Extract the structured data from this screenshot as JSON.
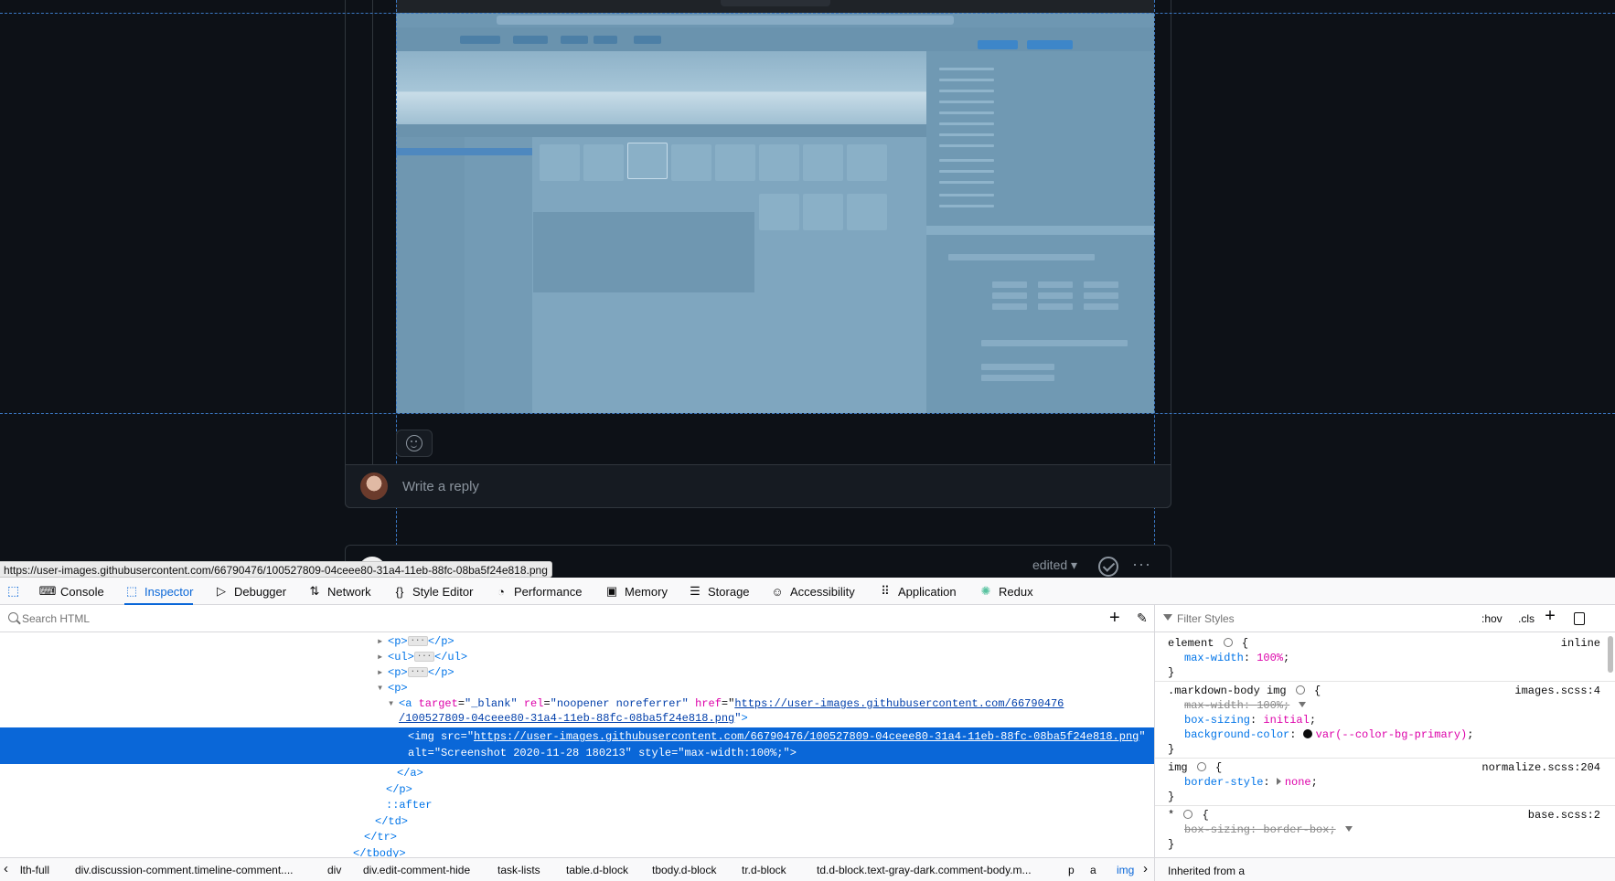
{
  "page": {
    "reply_placeholder": "Write a reply",
    "edited_label": "edited",
    "status_url": "https://user-images.githubusercontent.com/66790476/100527809-04ceee80-31a4-11eb-88fc-08ba5f24e818.png"
  },
  "devtools": {
    "tabs": [
      {
        "label": "Console",
        "icon": "console-icon"
      },
      {
        "label": "Inspector",
        "icon": "inspector-icon"
      },
      {
        "label": "Debugger",
        "icon": "debugger-icon"
      },
      {
        "label": "Network",
        "icon": "network-icon"
      },
      {
        "label": "Style Editor",
        "icon": "style-editor-icon"
      },
      {
        "label": "Performance",
        "icon": "performance-icon"
      },
      {
        "label": "Memory",
        "icon": "memory-icon"
      },
      {
        "label": "Storage",
        "icon": "storage-icon"
      },
      {
        "label": "Accessibility",
        "icon": "accessibility-icon"
      },
      {
        "label": "Application",
        "icon": "application-icon"
      },
      {
        "label": "Redux",
        "icon": "redux-icon"
      }
    ],
    "active_tab": "Inspector",
    "search_placeholder": "Search HTML",
    "filter_placeholder": "Filter Styles",
    "hov_label": ":hov",
    "cls_label": ".cls",
    "tree": {
      "p1": "<p>",
      "p1_close": "</p>",
      "ul": "<ul>",
      "ul_close": "</ul>",
      "p2": "<p>",
      "p2_close": "</p>",
      "p3": "<p>",
      "a_tag": "<a",
      "a_attr1": "target",
      "a_val1": "\"_blank\"",
      "a_attr2": "rel",
      "a_val2": "\"noopener noreferrer\"",
      "a_attr3": "href",
      "a_href1": "https://user-images.githubusercontent.com/66790476",
      "a_href2": "/100527809-04ceee80-31a4-11eb-88fc-08ba5f24e818.png",
      "img_tag": "<img",
      "img_attr_src": "src",
      "img_src": "https://user-images.githubusercontent.com/66790476/100527809-04ceee80-31a4-11eb-88fc-08ba5f24e818.png",
      "img_attr_alt": "alt",
      "img_alt": "\"Screenshot 2020-11-28 180213\"",
      "img_attr_style": "style",
      "img_style": "\"max-width:100%;\"",
      "a_close": "</a>",
      "p_close": "</p>",
      "after": "::after",
      "td_close": "</td>",
      "tr_close": "</tr>",
      "tbody_close": "</tbody>"
    },
    "breadcrumbs": [
      "lth-full",
      "div.discussion-comment.timeline-comment....",
      "div",
      "div.edit-comment-hide",
      "task-lists",
      "table.d-block",
      "tbody.d-block",
      "tr.d-block",
      "td.d-block.text-gray-dark.comment-body.m...",
      "p",
      "a",
      "img"
    ],
    "rules": {
      "r1_selector": "element",
      "r1_source": "inline",
      "r1_p1_name": "max-width",
      "r1_p1_val": "100%",
      "r2_selector": ".markdown-body img",
      "r2_source": "images.scss:4",
      "r2_p1_name": "max-width",
      "r2_p1_val": "100%",
      "r2_p2_name": "box-sizing",
      "r2_p2_val": "initial",
      "r2_p3_name": "background-color",
      "r2_p3_val": "var(--color-bg-primary)",
      "r3_selector": "img",
      "r3_source": "normalize.scss:204",
      "r3_p1_name": "border-style",
      "r3_p1_val": "none",
      "r4_selector": "*",
      "r4_source": "base.scss:2",
      "r4_p1_name": "box-sizing",
      "r4_p1_val": "border-box",
      "inherited": "Inherited from a"
    }
  },
  "colors": {
    "page_bg": "#0d1117",
    "highlight_overlay": "#7fa6bf",
    "selection_blue": "#0a67d8"
  }
}
